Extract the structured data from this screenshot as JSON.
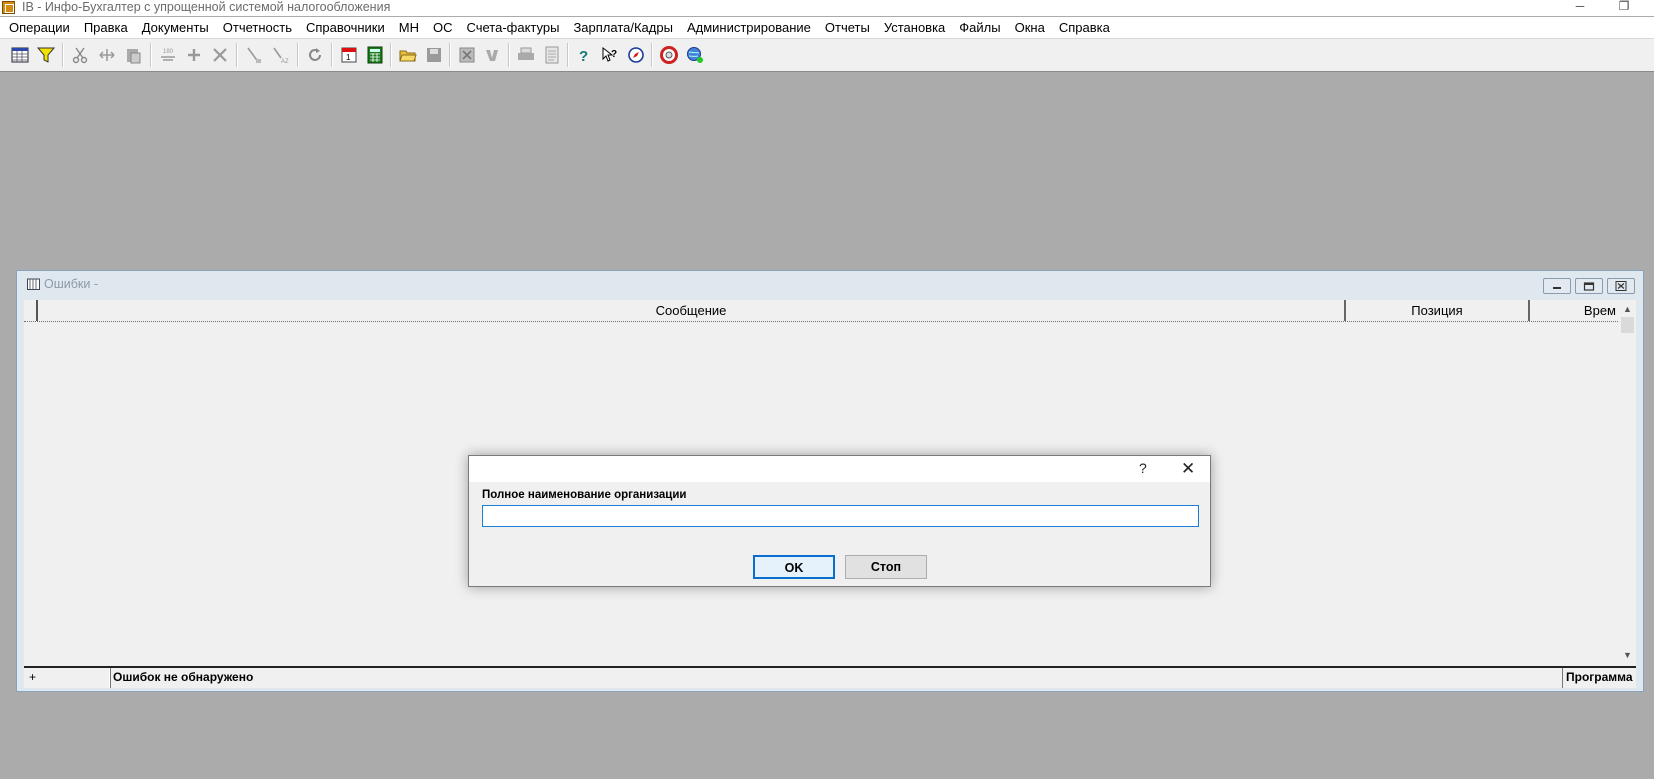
{
  "window": {
    "title": "IB - Инфо-Бухгалтер с упрощенной системой налогообложения",
    "min_glyph": "─",
    "restore_glyph": "❐"
  },
  "menu": [
    "Операции",
    "Правка",
    "Документы",
    "Отчетность",
    "Справочники",
    "МН",
    "ОС",
    "Счета-фактуры",
    "Зарплата/Кадры",
    "Администрирование",
    "Отчеты",
    "Установка",
    "Файлы",
    "Окна",
    "Справка"
  ],
  "toolbar_icons": [
    "table-view-icon",
    "filter-icon",
    "cut-icon",
    "move-icon",
    "paste-icon",
    "numbering-icon",
    "add-icon",
    "delete-icon",
    "sort-icon",
    "sort-az-icon",
    "refresh-icon",
    "calendar-icon",
    "calculator-icon",
    "open-folder-icon",
    "save-icon",
    "export-excel-icon",
    "export-word-icon",
    "print-icon",
    "print-preview-icon",
    "help-icon",
    "context-help-icon",
    "compass-icon",
    "lifebuoy-icon",
    "web-icon"
  ],
  "errors_window": {
    "title": "Ошибки -",
    "columns": [
      "Сообщение",
      "Позиция",
      "Врем"
    ],
    "status_left": "+",
    "status_message": "Ошибок не обнаружено",
    "status_right": "Программа",
    "scroll_up": "▲",
    "scroll_down": "▼"
  },
  "dialog": {
    "help": "?",
    "close": "✕",
    "label": "Полное наименование организации",
    "value": "",
    "ok_label": "OK",
    "stop_label": "Стоп"
  },
  "colors": {
    "workspace": "#ababab",
    "accent": "#0a6ed1",
    "mdi_frame": "#dfe7ef"
  }
}
